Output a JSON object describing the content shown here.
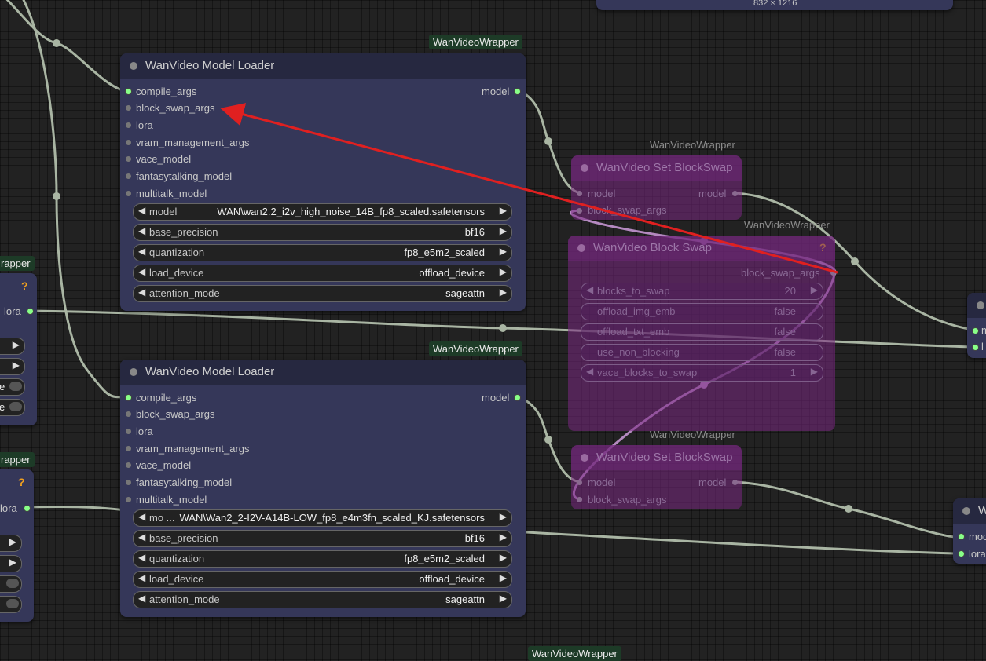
{
  "top_node": {
    "label": "832 × 1216"
  },
  "badges": {
    "b1": "WanVideoWrapper",
    "b2": "WanVideoWrapper",
    "b3": "WanVideoWrapper",
    "bottom": "WanVideoWrapper",
    "left1": "rapper",
    "left2": "rapper"
  },
  "dim_badges": {
    "d1": "WanVideoWrapper",
    "d2": "WanVideoWrapper",
    "d3": "WanVideoWrapper"
  },
  "loader1": {
    "title": "WanVideo Model Loader",
    "inputs": [
      "compile_args",
      "block_swap_args",
      "lora",
      "vram_management_args",
      "vace_model",
      "fantasytalking_model",
      "multitalk_model"
    ],
    "output": "model",
    "widgets": [
      {
        "name": "model",
        "value": "WAN\\wan2.2_i2v_high_noise_14B_fp8_scaled.safetensors"
      },
      {
        "name": "base_precision",
        "value": "bf16"
      },
      {
        "name": "quantization",
        "value": "fp8_e5m2_scaled"
      },
      {
        "name": "load_device",
        "value": "offload_device"
      },
      {
        "name": "attention_mode",
        "value": "sageattn"
      }
    ]
  },
  "loader2": {
    "title": "WanVideo Model Loader",
    "inputs": [
      "compile_args",
      "block_swap_args",
      "lora",
      "vram_management_args",
      "vace_model",
      "fantasytalking_model",
      "multitalk_model"
    ],
    "output": "model",
    "widgets": [
      {
        "name": "mo ...",
        "value": "WAN\\Wan2_2-I2V-A14B-LOW_fp8_e4m3fn_scaled_KJ.safetensors"
      },
      {
        "name": "base_precision",
        "value": "bf16"
      },
      {
        "name": "quantization",
        "value": "fp8_e5m2_scaled"
      },
      {
        "name": "load_device",
        "value": "offload_device"
      },
      {
        "name": "attention_mode",
        "value": "sageattn"
      }
    ]
  },
  "setswap1": {
    "title": "WanVideo Set BlockSwap",
    "in_model": "model",
    "in_args": "block_swap_args",
    "out": "model"
  },
  "setswap2": {
    "title": "WanVideo Set BlockSwap",
    "in_model": "model",
    "in_args": "block_swap_args",
    "out": "model"
  },
  "blockswap": {
    "title": "WanVideo Block Swap",
    "output": "block_swap_args",
    "question": "?",
    "widgets": [
      {
        "name": "blocks_to_swap",
        "value": "20"
      },
      {
        "name": "offload_img_emb",
        "value": "false"
      },
      {
        "name": "offload_txt_emb",
        "value": "false"
      },
      {
        "name": "use_non_blocking",
        "value": "false"
      },
      {
        "name": "vace_blocks_to_swap",
        "value": "1"
      }
    ]
  },
  "left_node1": {
    "question": "?",
    "output": "lora",
    "toggle_a": "e",
    "toggle_b": "e"
  },
  "left_node2": {
    "question": "?",
    "output": "lora"
  },
  "right_node1": {
    "in_a": "m",
    "in_b": "l"
  },
  "right_node2": {
    "title": "W",
    "in_a": "moc",
    "in_b": "lora"
  },
  "colors": {
    "node_bg": "#353759",
    "header_bg": "#262840",
    "connected_dot": "#88ff88",
    "annotation_arrow": "#e02020",
    "dim_node": "#7a2882"
  }
}
